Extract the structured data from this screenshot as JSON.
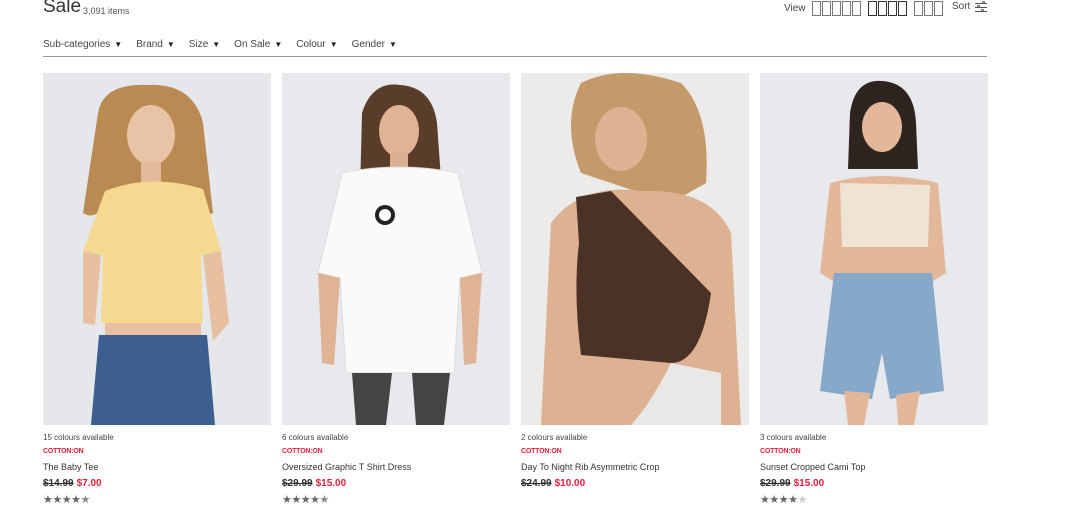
{
  "header": {
    "title": "Sale",
    "count": "3,091 items",
    "view_label": "View",
    "sort_label": "Sort"
  },
  "filters": [
    "Sub-categories",
    "Brand",
    "Size",
    "On Sale",
    "Colour",
    "Gender"
  ],
  "products": [
    {
      "colours": "15 colours available",
      "brand": "COTTON:ON",
      "name": "The Baby Tee",
      "old_price": "$14.99",
      "new_price": "$7.00",
      "rating": 4.5
    },
    {
      "colours": "6 colours available",
      "brand": "COTTON:ON",
      "name": "Oversized Graphic T Shirt Dress",
      "old_price": "$29.99",
      "new_price": "$15.00",
      "rating": 4.5
    },
    {
      "colours": "2 colours available",
      "brand": "COTTON:ON",
      "name": "Day To Night Rib Asymmetric Crop",
      "old_price": "$24.99",
      "new_price": "$10.00",
      "rating": 0
    },
    {
      "colours": "3 colours available",
      "brand": "COTTON:ON",
      "name": "Sunset Cropped Cami Top",
      "old_price": "$29.99",
      "new_price": "$15.00",
      "rating": 4
    }
  ],
  "colors": {
    "accent": "#e01f3d",
    "image_bg": "#e4e4e4"
  }
}
